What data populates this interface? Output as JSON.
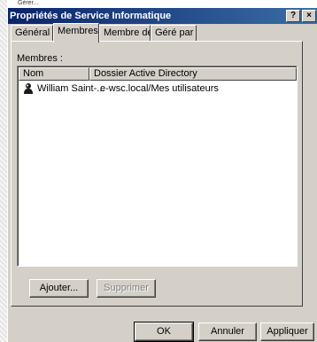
{
  "background_text": "Gérer...",
  "window": {
    "title": "Propriétés de Service Informatique",
    "help_button": "?",
    "close_button": "×"
  },
  "tabs": [
    {
      "label": "Général",
      "active": false
    },
    {
      "label": "Membres",
      "active": true
    },
    {
      "label": "Membre de",
      "active": false
    },
    {
      "label": "Géré par",
      "active": false
    }
  ],
  "members": {
    "label": "Membres :",
    "columns": [
      "Nom",
      "Dossier Active Directory"
    ],
    "rows": [
      {
        "name": "William Saint-...",
        "folder": "e-wsc.local/Mes utilisateurs",
        "icon": "user-icon"
      }
    ]
  },
  "panel_buttons": {
    "add": "Ajouter...",
    "remove": "Supprimer"
  },
  "dialog_buttons": {
    "ok": "OK",
    "cancel": "Annuler",
    "apply": "Appliquer"
  }
}
